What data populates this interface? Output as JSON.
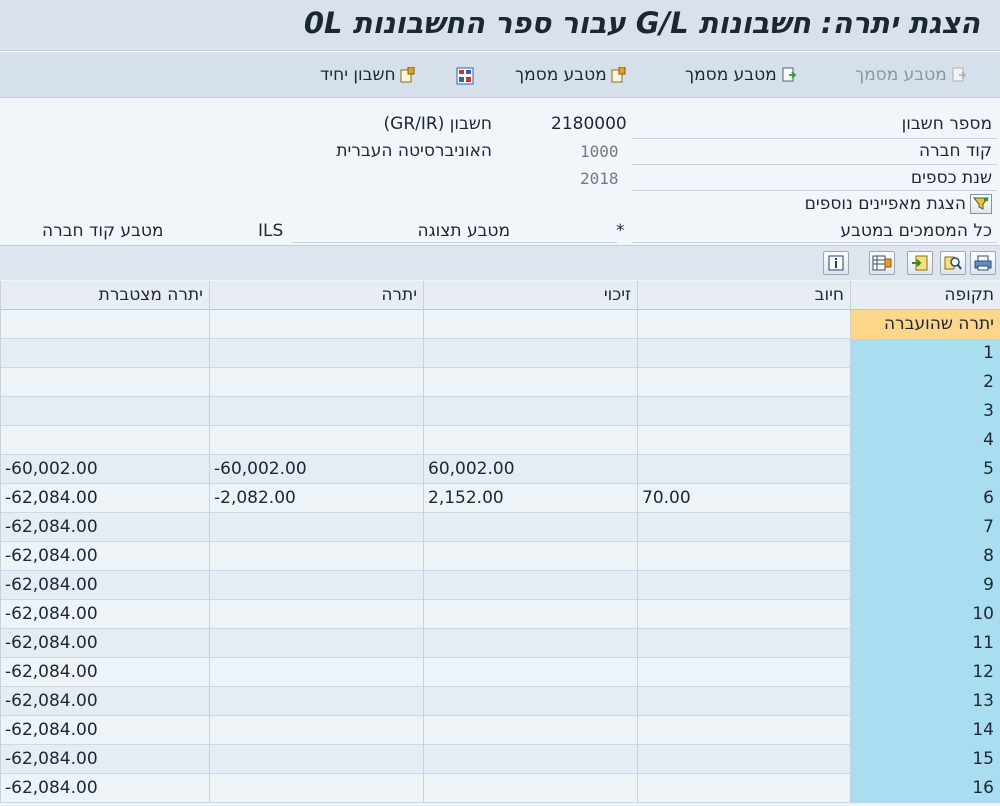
{
  "window": {
    "title": "הצגת יתרה: חשבונות G/L עבור ספר החשבונות 0L"
  },
  "toolbar": {
    "doc_currency_disabled": "מטבע מסמך",
    "doc_currency": "מטבע מסמך",
    "doc_currency_2": "מטבע מסמך",
    "single_account": "חשבון יחיד"
  },
  "header": {
    "account_number_label": "מספר חשבון",
    "account_number_value": "2180000",
    "account_name": "חשבון (GR/IR)",
    "company_code_label": "קוד חברה",
    "company_code_value": "1000",
    "company_name": "האוניברסיטה העברית",
    "fiscal_year_label": "שנת כספים",
    "fiscal_year_value": "2018",
    "more_chars_label": "הצגת מאפיינים נוספים",
    "all_docs_label": "כל המסמכים במטבע",
    "all_docs_value": "*",
    "display_currency_label": "מטבע תצוגה",
    "display_currency_value": "ILS",
    "company_currency_label": "מטבע קוד חברה"
  },
  "grid": {
    "columns": {
      "period": "תקופה",
      "debit": "חיוב",
      "credit": "זיכוי",
      "balance": "יתרה",
      "cumulative": "יתרה מצטברת"
    },
    "rows": [
      {
        "period": "יתרה שהועברה",
        "debit": "",
        "credit": "",
        "balance": "",
        "cumulative": ""
      },
      {
        "period": "1",
        "debit": "",
        "credit": "",
        "balance": "",
        "cumulative": ""
      },
      {
        "period": "2",
        "debit": "",
        "credit": "",
        "balance": "",
        "cumulative": ""
      },
      {
        "period": "3",
        "debit": "",
        "credit": "",
        "balance": "",
        "cumulative": ""
      },
      {
        "period": "4",
        "debit": "",
        "credit": "",
        "balance": "",
        "cumulative": ""
      },
      {
        "period": "5",
        "debit": "",
        "credit": "60,002.00",
        "balance": "-60,002.00",
        "cumulative": "-60,002.00"
      },
      {
        "period": "6",
        "debit": "70.00",
        "credit": "2,152.00",
        "balance": "-2,082.00",
        "cumulative": "-62,084.00"
      },
      {
        "period": "7",
        "debit": "",
        "credit": "",
        "balance": "",
        "cumulative": "-62,084.00"
      },
      {
        "period": "8",
        "debit": "",
        "credit": "",
        "balance": "",
        "cumulative": "-62,084.00"
      },
      {
        "period": "9",
        "debit": "",
        "credit": "",
        "balance": "",
        "cumulative": "-62,084.00"
      },
      {
        "period": "10",
        "debit": "",
        "credit": "",
        "balance": "",
        "cumulative": "-62,084.00"
      },
      {
        "period": "11",
        "debit": "",
        "credit": "",
        "balance": "",
        "cumulative": "-62,084.00"
      },
      {
        "period": "12",
        "debit": "",
        "credit": "",
        "balance": "",
        "cumulative": "-62,084.00"
      },
      {
        "period": "13",
        "debit": "",
        "credit": "",
        "balance": "",
        "cumulative": "-62,084.00"
      },
      {
        "period": "14",
        "debit": "",
        "credit": "",
        "balance": "",
        "cumulative": "-62,084.00"
      },
      {
        "period": "15",
        "debit": "",
        "credit": "",
        "balance": "",
        "cumulative": "-62,084.00"
      },
      {
        "period": "16",
        "debit": "",
        "credit": "",
        "balance": "",
        "cumulative": "-62,084.00"
      }
    ]
  }
}
